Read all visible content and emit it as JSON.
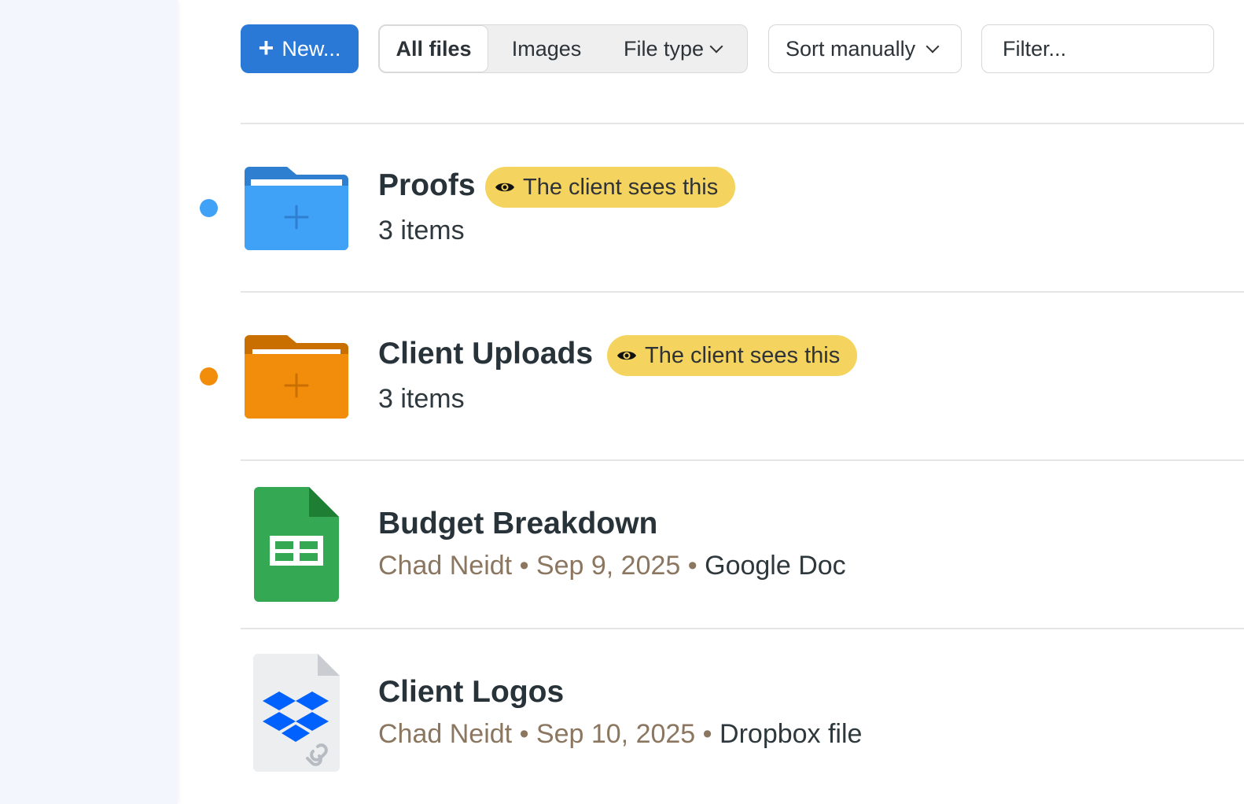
{
  "toolbar": {
    "new_label": "New...",
    "tabs": [
      "All files",
      "Images",
      "File type"
    ],
    "sort_label": "Sort manually",
    "filter_placeholder": "Filter..."
  },
  "items": [
    {
      "name": "Proofs",
      "kind": "folder",
      "dot_color": "#3fa2f7",
      "folder_color": "#3fa2f7",
      "badge": "The client sees this",
      "subtitle": "3 items"
    },
    {
      "name": "Client Uploads",
      "kind": "folder",
      "dot_color": "#f28c0b",
      "folder_color": "#f28c0b",
      "badge": "The client sees this",
      "subtitle": "3 items"
    },
    {
      "name": "Budget Breakdown",
      "kind": "google-sheet",
      "author": "Chad Neidt",
      "date": "Sep 9, 2025",
      "type": "Google Doc",
      "separator": "•"
    },
    {
      "name": "Client Logos",
      "kind": "dropbox-file",
      "author": "Chad Neidt",
      "date": "Sep 10, 2025",
      "type": "Dropbox file",
      "separator": "•"
    }
  ],
  "colors": {
    "accent": "#2a79d6",
    "badge_bg": "#f4d35e",
    "sheets_green": "#34a853",
    "dropbox_blue": "#0061fe"
  }
}
